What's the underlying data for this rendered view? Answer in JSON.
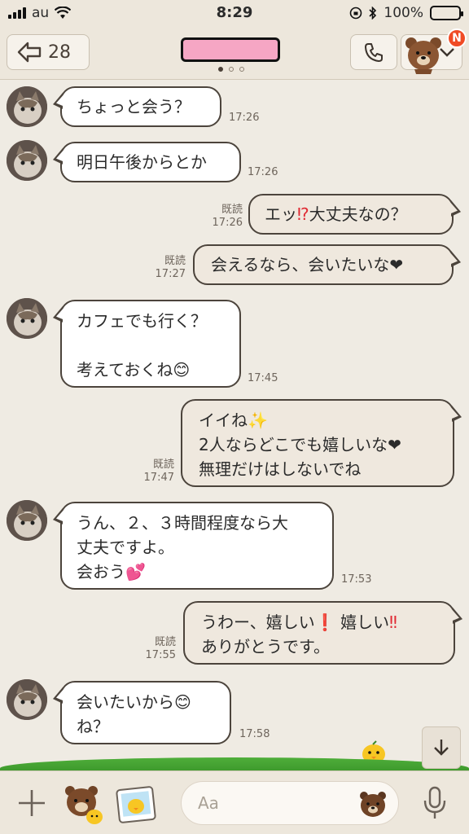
{
  "status_bar": {
    "carrier": "au",
    "time": "8:29",
    "battery": "100%"
  },
  "header": {
    "back_count": "28",
    "badge": "N"
  },
  "messages": [
    {
      "side": "in",
      "text": "ちょっと会う？",
      "time": "17:26"
    },
    {
      "side": "in",
      "text": "明日午後からとか",
      "time": "17:26"
    },
    {
      "side": "out",
      "read": "既読",
      "time": "17:26",
      "pre": "エッ",
      "mark": "⁉",
      "post": "大丈夫なの？"
    },
    {
      "side": "out",
      "read": "既読",
      "time": "17:27",
      "text": "会えるなら、会いたいな❤"
    },
    {
      "side": "in",
      "text": "カフェでも行く？\n\n考えておくね😊",
      "time": "17:45"
    },
    {
      "side": "out",
      "read": "既読",
      "time": "17:47",
      "text": "イイね✨\n2人ならどこでも嬉しいな❤\n無理だけはしないでね"
    },
    {
      "side": "in",
      "text": "うん、２、３時間程度なら大\n丈夫ですよ。\n会おう💕",
      "time": "17:53"
    },
    {
      "side": "out",
      "read": "既読",
      "time": "17:55",
      "pre": "うわー、嬉しい",
      "mark": "❗",
      "mid": " 嬉しい",
      "mark2": "‼",
      "line2": "ありがとうです。"
    },
    {
      "side": "in",
      "text": "会いたいから😊\nね？",
      "time": "17:58"
    }
  ],
  "input": {
    "placeholder": "Aa"
  },
  "colors": {
    "background": "#efebe3",
    "header": "#ede7dc",
    "bubble_border": "#4c443c",
    "badge": "#f04b25",
    "name_censor": "#f6a6c4"
  }
}
